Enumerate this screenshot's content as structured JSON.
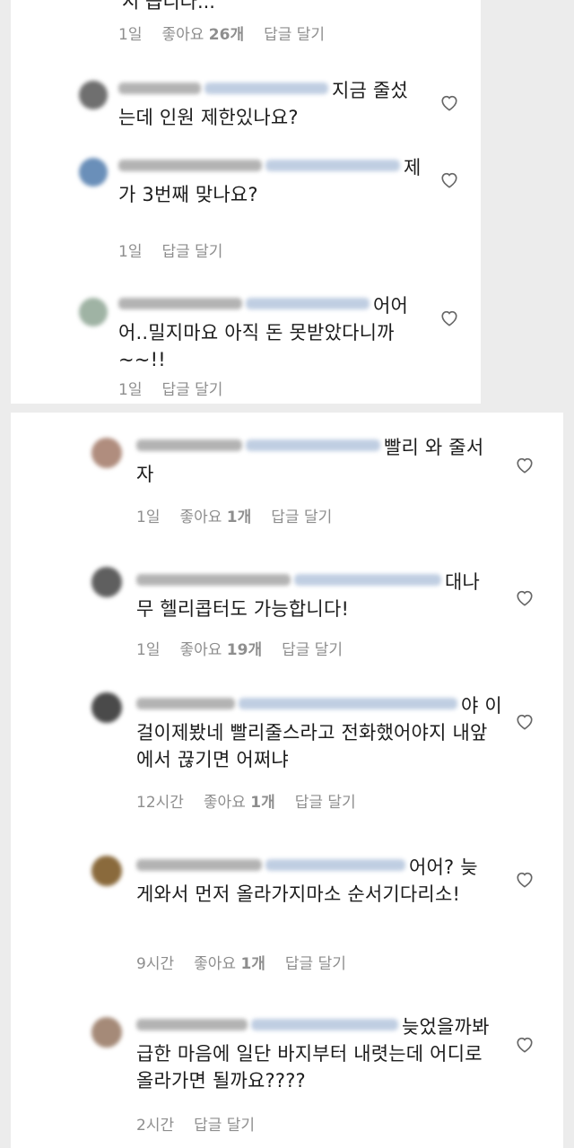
{
  "panel_1": {
    "cut_text": "시 습니다...",
    "top_meta": {
      "time": "1일",
      "likes_label": "좋아요",
      "likes_count": "26개",
      "reply": "답글 달기"
    },
    "comments": [
      {
        "text": "지금 줄섰는데 인원 제한있나요?"
      },
      {
        "text": "제가 3번째 맞나요?",
        "time": "1일",
        "reply": "답글 달기"
      },
      {
        "text": "어어어..밀지마요 아직 돈 못받았다니까~~!!",
        "time": "1일",
        "reply": "답글 달기"
      }
    ]
  },
  "panel_2": {
    "comments": [
      {
        "text": "빨리 와 줄서자",
        "time": "1일",
        "likes_label": "좋아요",
        "likes_count": "1개",
        "reply": "답글 달기"
      },
      {
        "text": "대나무 헬리콥터도 가능합니다!",
        "time": "1일",
        "likes_label": "좋아요",
        "likes_count": "19개",
        "reply": "답글 달기"
      },
      {
        "text": "야 이걸이제봤네 빨리줄스라고 전화했어야지 내앞에서 끊기면 어쩌냐",
        "time": "12시간",
        "likes_label": "좋아요",
        "likes_count": "1개",
        "reply": "답글 달기"
      },
      {
        "text": "어어? 늦게와서 먼저 올라가지마소 순서기다리소!",
        "time": "9시간",
        "likes_label": "좋아요",
        "likes_count": "1개",
        "reply": "답글 달기"
      },
      {
        "text": "늦었을까봐 급한 마음에 일단 바지부터 내렷는데 어디로 올라가면 될까요????",
        "time": "2시간",
        "reply": "답글 달기"
      }
    ]
  },
  "colors": {
    "meta": "#8e8e8e",
    "mention": "#b5c6dd",
    "background": "#ececec"
  },
  "icons": {
    "like": "heart-outline-icon"
  }
}
